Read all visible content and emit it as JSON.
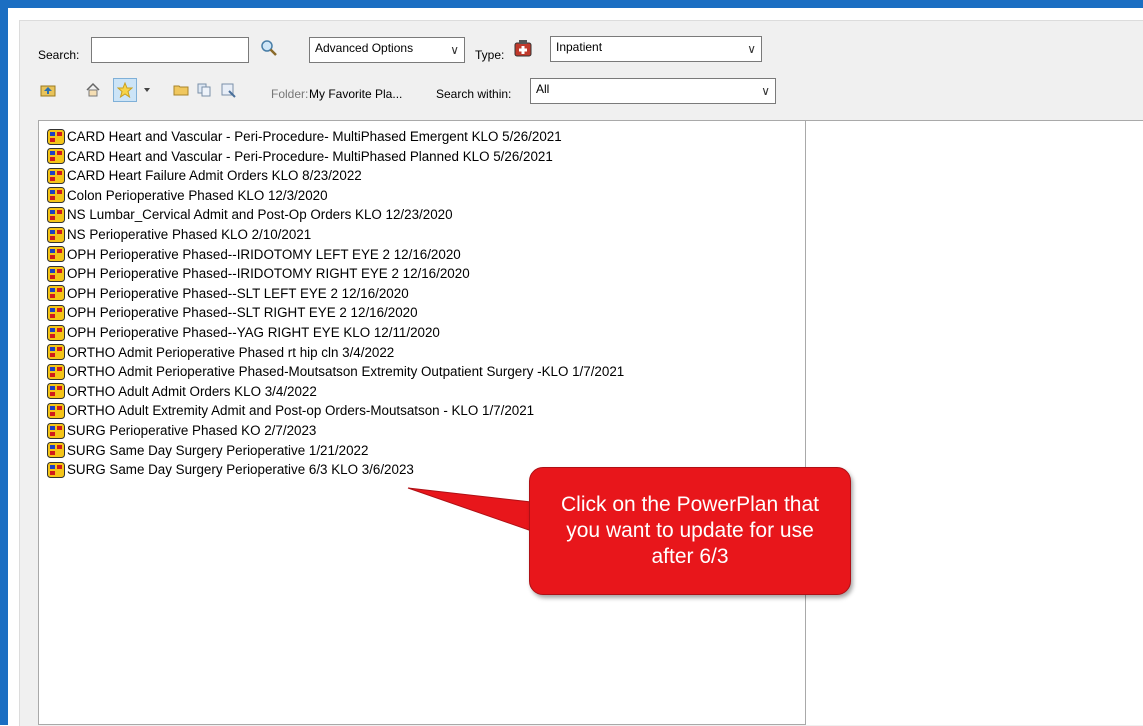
{
  "search": {
    "label": "Search:",
    "value": "",
    "advanced_options": "Advanced Options",
    "type_label": "Type:",
    "type_value": "Inpatient"
  },
  "toolbar": {
    "folder_label": "Folder:",
    "folder_value": "My Favorite Pla...",
    "search_within_label": "Search within:",
    "search_within_value": "All"
  },
  "plans": [
    "CARD Heart and Vascular - Peri-Procedure- MultiPhased Emergent KLO  5/26/2021",
    "CARD Heart and Vascular - Peri-Procedure- MultiPhased Planned KLO  5/26/2021",
    "CARD Heart Failure Admit Orders KLO  8/23/2022",
    "Colon Perioperative Phased KLO  12/3/2020",
    "NS Lumbar_Cervical Admit and Post-Op Orders KLO  12/23/2020",
    "NS Perioperative Phased KLO  2/10/2021",
    "OPH Perioperative Phased--IRIDOTOMY LEFT EYE 2  12/16/2020",
    "OPH Perioperative Phased--IRIDOTOMY RIGHT EYE 2  12/16/2020",
    "OPH Perioperative Phased--SLT LEFT EYE 2  12/16/2020",
    "OPH Perioperative Phased--SLT RIGHT EYE 2  12/16/2020",
    "OPH Perioperative Phased--YAG RIGHT EYE KLO  12/11/2020",
    "ORTHO Admit Perioperative Phased rt hip cln  3/4/2022",
    "ORTHO Admit Perioperative Phased-Moutsatson Extremity Outpatient Surgery -KLO  1/7/2021",
    "ORTHO Adult Admit Orders KLO  3/4/2022",
    "ORTHO Adult Extremity Admit and Post-op Orders-Moutsatson - KLO  1/7/2021",
    "SURG Perioperative Phased KO  2/7/2023",
    "SURG Same Day Surgery Perioperative  1/21/2022",
    "SURG Same Day Surgery Perioperative 6/3 KLO  3/6/2023"
  ],
  "callout": {
    "text": "Click on the PowerPlan that you want to update for use after 6/3"
  },
  "colors": {
    "accent": "#1b6ec2",
    "callout": "#e8161b"
  }
}
